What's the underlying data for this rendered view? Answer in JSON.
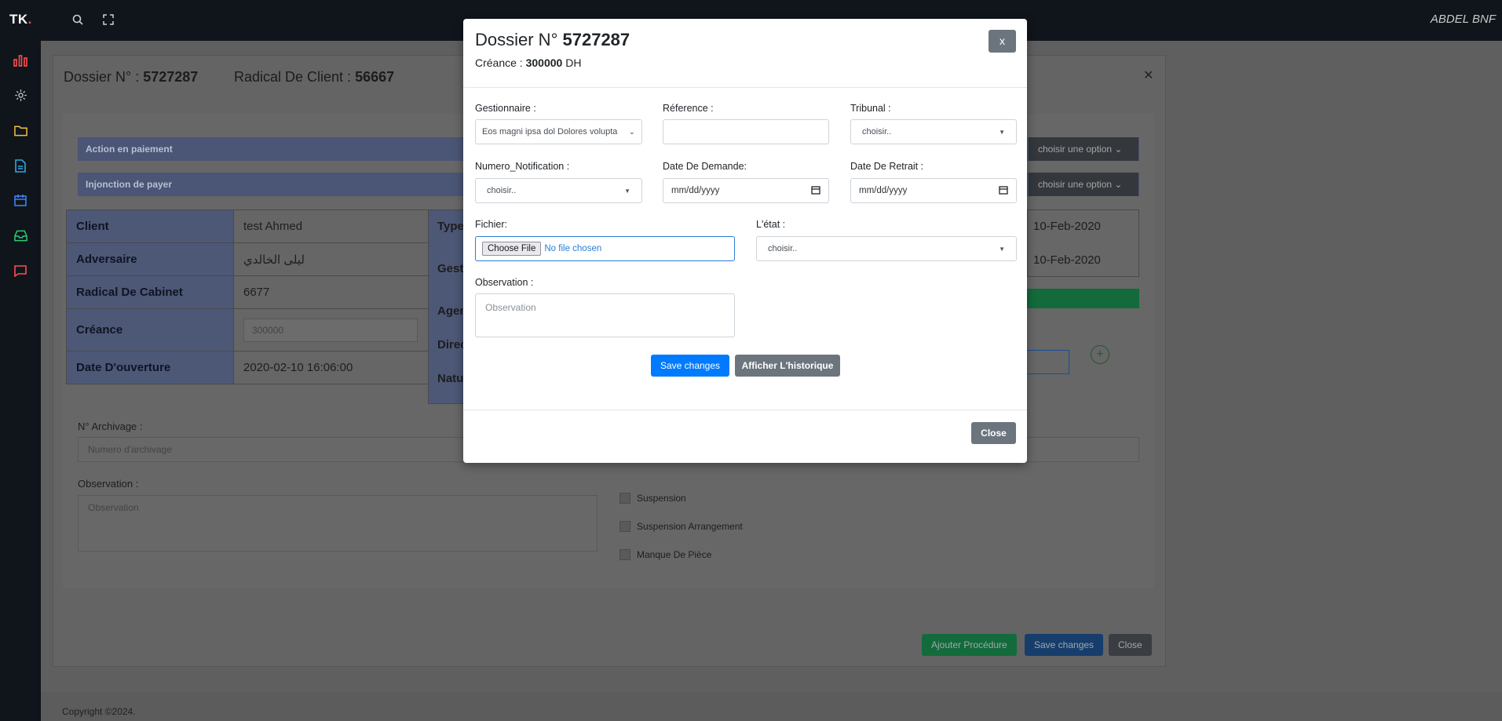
{
  "topbar": {
    "brand": "TK",
    "brand_dot": ".",
    "user_name": "ABDEL BNF"
  },
  "sidebar": {
    "items": [
      {
        "icon": "bar-chart-icon",
        "color": "#ff4d4d"
      },
      {
        "icon": "gear-icon",
        "color": "#c9c9c9"
      },
      {
        "icon": "folder-icon",
        "color": "#f0c040"
      },
      {
        "icon": "file-icon",
        "color": "#2ea7e0"
      },
      {
        "icon": "calendar-icon",
        "color": "#3b82f6"
      },
      {
        "icon": "inbox-icon",
        "color": "#2ecc71"
      },
      {
        "icon": "chat-icon",
        "color": "#ff4d4d"
      }
    ]
  },
  "background": {
    "dossier_label": "Dossier N° :",
    "dossier_number": "5727287",
    "radical_label": "Radical De Client :",
    "radical_number": "56667",
    "bar1": "Action en paiement",
    "bar2": "Injonction de payer",
    "option1": "choisir une option",
    "option2": "choisir une option",
    "table_rows": [
      {
        "label": "Client",
        "value": "test Ahmed"
      },
      {
        "label": "Adversaire",
        "value": "ليلى الخالدي"
      },
      {
        "label": "Radical De Cabinet",
        "value": "6677"
      },
      {
        "label": "Créance",
        "value": "300000"
      },
      {
        "label": "Date D'ouverture",
        "value": "2020-02-10 16:06:00"
      }
    ],
    "right_labels": [
      "Type",
      "Gesti",
      "Agen",
      "Direc",
      "Natu"
    ],
    "date1": "10-Feb-2020",
    "date2": "10-Feb-2020",
    "archivage_label": "N° Archivage :",
    "archivage_placeholder": "Numero d'archivage",
    "observation_label": "Observation :",
    "observation_placeholder": "Observation",
    "checks": [
      "Suspension",
      "Suspension Arrangement",
      "Manque De Pièce"
    ],
    "btn_ajouter": "Ajouter Procédure",
    "btn_save": "Save changes",
    "btn_close": "Close",
    "copyright": "Copyright ©2024."
  },
  "modal": {
    "title_prefix": "Dossier N°",
    "title_number": "5727287",
    "creance_label": "Créance :",
    "creance_value": "300000",
    "creance_unit": "DH",
    "close_x": "x",
    "gestionnaire_label": "Gestionnaire :",
    "gestionnaire_value": "Eos magni ipsa dol Dolores volupta",
    "reference_label": "Réference :",
    "reference_value": "",
    "tribunal_label": "Tribunal :",
    "tribunal_value": "choisir..",
    "notification_label": "Numero_Notification :",
    "notification_value": "choisir..",
    "date_demande_label": "Date De Demande:",
    "date_demande_value": "mm/dd/yyyy",
    "date_retrait_label": "Date De Retrait :",
    "date_retrait_value": "mm/dd/yyyy",
    "fichier_label": "Fichier:",
    "choose_file": "Choose File",
    "no_file": "No file chosen",
    "etat_label": "L'état :",
    "etat_value": "choisir..",
    "observation_label": "Observation :",
    "observation_placeholder": "Observation",
    "save_btn": "Save changes",
    "history_btn": "Afficher L'historique",
    "close_btn": "Close"
  }
}
